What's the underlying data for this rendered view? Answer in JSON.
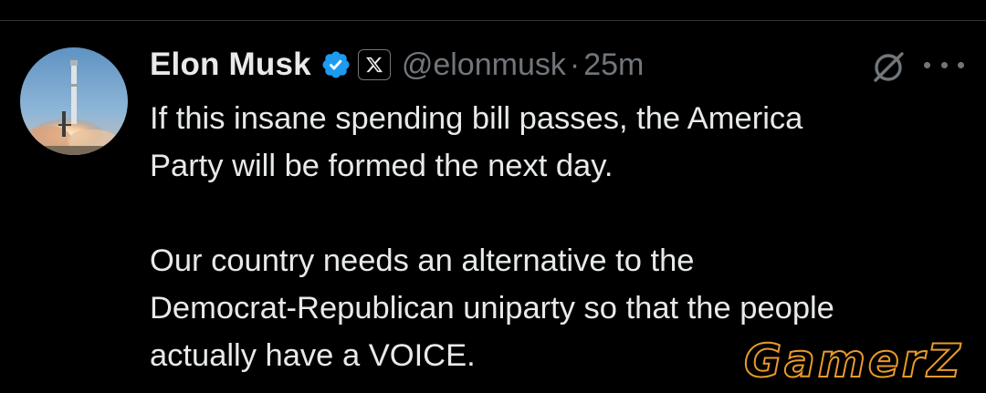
{
  "tweet": {
    "author_name": "Elon Musk",
    "handle": "@elonmusk",
    "separator": "·",
    "time": "25m",
    "paragraphs": [
      [
        "If this insane spending bill passes, the America",
        "Party will be formed the next day."
      ],
      [
        "Our country needs an alternative to the",
        "Democrat-Republican uniparty so that the people",
        "actually have a VOICE."
      ]
    ]
  },
  "icons": {
    "verified": "verified-badge-icon",
    "affiliate": "x-logo-icon",
    "grok": "grok-icon",
    "more": "more-options-icon"
  },
  "watermark": {
    "text": "GamerZ"
  },
  "colors": {
    "background": "#000000",
    "text_primary": "#e7e9ea",
    "text_secondary": "#71767b",
    "verified_blue": "#1d9bf0",
    "watermark_stroke": "#e89a2c"
  }
}
